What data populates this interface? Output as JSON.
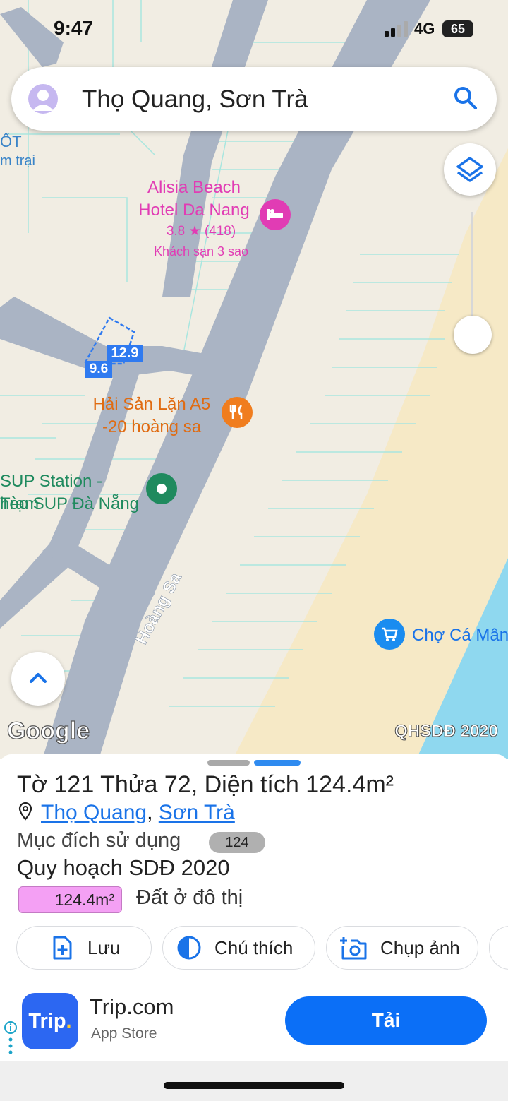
{
  "status_bar": {
    "time": "9:47",
    "network": "4G",
    "battery": "65"
  },
  "search": {
    "query": "Thọ Quang, Sơn Trà"
  },
  "map": {
    "pois": {
      "hotel_name": "Alisia Beach Hotel Da Nang",
      "hotel_line1": "Alisia Beach",
      "hotel_line2": "Hotel Da Nang",
      "hotel_rating": "3.8 ★ (418)",
      "hotel_class": "Khách sạn 3 sao",
      "restaurant_line1": "Hải Sản Lặn A5",
      "restaurant_line2": "-20 hoàng sa",
      "sup_line1": "SUP Station - Trạm",
      "sup_line2": "hèo SUP Đà Nẵng",
      "market": "Chợ Cá Mân",
      "left_edge_1": "ỐT",
      "left_edge_2": "m trại"
    },
    "road_name": "Hoàng Sa",
    "parcel_dimension_1": "12.9",
    "parcel_dimension_2": "9.6",
    "google_logo": "Google",
    "overlay_label": "QHSDĐ 2020"
  },
  "sheet": {
    "title_to": "Tờ ",
    "title_to_num": "121",
    "title_thua": " Thửa ",
    "title_thua_num": "72",
    "title_area": ", Diện tích 124.4m²",
    "location_ward": "Thọ Quang",
    "location_sep": ", ",
    "location_district": "Sơn Trà",
    "purpose_label": "Mục đích sử dụng",
    "purpose_code": "124",
    "plan_title": "Quy hoạch SDĐ 2020",
    "plan_area": "124.4m²",
    "plan_land_type": "Đất ở đô thị",
    "actions": {
      "save": "Lưu",
      "legend": "Chú thích",
      "photo": "Chụp ảnh"
    }
  },
  "ad": {
    "app_icon_text": "Trip",
    "app_icon_dot": ".",
    "app_name": "Trip.com",
    "store": "App Store",
    "install": "Tải"
  },
  "colors": {
    "map_land": "#f1ede3",
    "road": "#aab4c4",
    "beach": "#f6e9c6",
    "water": "#8fd8ef",
    "accent_blue": "#1a73e8",
    "hotel_pink": "#e13cb4",
    "restaurant_orange": "#e06b11",
    "park_green": "#1f8a5e",
    "plan_pink": "#f4a0f4"
  }
}
